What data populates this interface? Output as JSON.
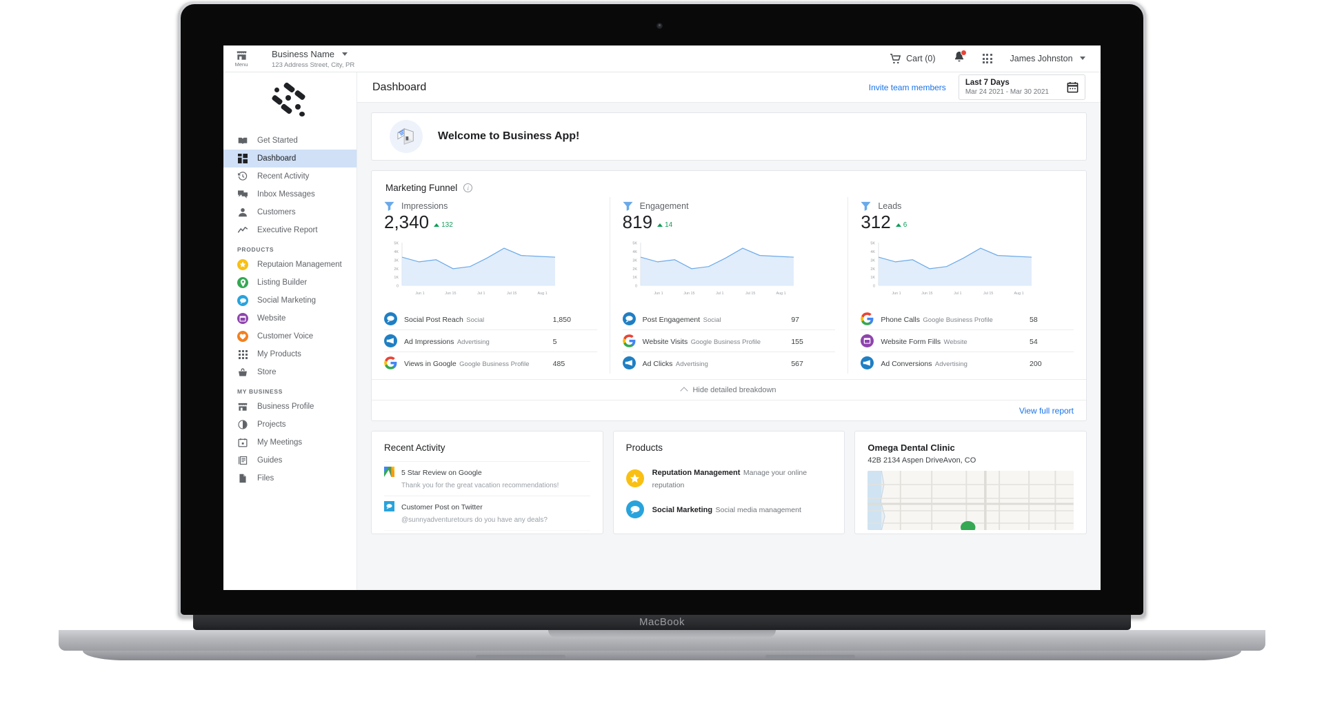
{
  "device": {
    "brand_label": "MacBook"
  },
  "topbar": {
    "menu_label": "Menu",
    "business_name": "Business Name",
    "business_address": "123 Address Street, City, PR",
    "cart_label": "Cart (0)",
    "user_name": "James Johnston"
  },
  "page": {
    "title": "Dashboard",
    "invite_link": "Invite team members",
    "date_label": "Last 7 Days",
    "date_range": "Mar 24 2021 - Mar 30 2021"
  },
  "welcome": {
    "text": "Welcome to Business App!"
  },
  "sidebar": {
    "main_items": [
      {
        "label": "Get Started",
        "icon": "book-icon",
        "active": false
      },
      {
        "label": "Dashboard",
        "icon": "dashboard-icon",
        "active": true
      },
      {
        "label": "Recent Activity",
        "icon": "history-icon",
        "active": false
      },
      {
        "label": "Inbox Messages",
        "icon": "chat-icon",
        "active": false
      },
      {
        "label": "Customers",
        "icon": "person-icon",
        "active": false
      },
      {
        "label": "Executive Report",
        "icon": "trending-icon",
        "active": false
      }
    ],
    "products_header": "PRODUCTS",
    "product_items": [
      {
        "label": "Reputaion Management",
        "icon": "star-circle-icon",
        "color": "#f9c013"
      },
      {
        "label": "Listing Builder",
        "icon": "map-pin-circle-icon",
        "color": "#34a853"
      },
      {
        "label": "Social Marketing",
        "icon": "social-circle-icon",
        "color": "#29a3dc"
      },
      {
        "label": "Website",
        "icon": "window-circle-icon",
        "color": "#8e44ad"
      },
      {
        "label": "Customer Voice",
        "icon": "heart-circle-icon",
        "color": "#f2801f"
      },
      {
        "label": "My Products",
        "icon": "grid-icon",
        "color": "#5f6368"
      },
      {
        "label": "Store",
        "icon": "basket-icon",
        "color": "#5f6368"
      }
    ],
    "business_header": "MY BUSINESS",
    "business_items": [
      {
        "label": "Business Profile",
        "icon": "storefront-icon"
      },
      {
        "label": "Projects",
        "icon": "pie-clock-icon"
      },
      {
        "label": "My Meetings",
        "icon": "calendar-icon"
      },
      {
        "label": "Guides",
        "icon": "guide-icon"
      },
      {
        "label": "Files",
        "icon": "file-icon"
      }
    ]
  },
  "funnel": {
    "title": "Marketing Funnel",
    "info_icon": "info-icon",
    "hide_breakdown_label": "Hide detailed breakdown",
    "view_full_report_label": "View full report",
    "columns": [
      {
        "name": "Impressions",
        "value": "2,340",
        "delta": "132",
        "breakdown": [
          {
            "label": "Social Post Reach",
            "sub": "Social",
            "value": "1,850",
            "bar_pct": 100,
            "icon": "social-circle-icon"
          },
          {
            "label": "Ad Impressions",
            "sub": "Advertising",
            "value": "5",
            "bar_pct": 14,
            "icon": "megaphone-circle-icon"
          },
          {
            "label": "Views in Google",
            "sub": "Google Business Profile",
            "value": "485",
            "bar_pct": 63,
            "icon": "google-icon"
          }
        ]
      },
      {
        "name": "Engagement",
        "value": "819",
        "delta": "14",
        "breakdown": [
          {
            "label": "Post Engagement",
            "sub": "Social",
            "value": "97",
            "bar_pct": 26,
            "icon": "social-circle-icon"
          },
          {
            "label": "Website Visits",
            "sub": "Google Business Profile",
            "value": "155",
            "bar_pct": 40,
            "icon": "google-icon"
          },
          {
            "label": "Ad Clicks",
            "sub": "Advertising",
            "value": "567",
            "bar_pct": 100,
            "icon": "megaphone-circle-icon"
          }
        ]
      },
      {
        "name": "Leads",
        "value": "312",
        "delta": "6",
        "breakdown": [
          {
            "label": "Phone Calls",
            "sub": "Google Business Profile",
            "value": "58",
            "bar_pct": 44,
            "icon": "google-icon"
          },
          {
            "label": "Website Form Fills",
            "sub": "Website",
            "value": "54",
            "bar_pct": 36,
            "icon": "window-circle-icon"
          },
          {
            "label": "Ad Conversions",
            "sub": "Advertising",
            "value": "200",
            "bar_pct": 100,
            "icon": "megaphone-circle-icon"
          }
        ]
      }
    ]
  },
  "chart_data": [
    {
      "type": "area",
      "title": "Impressions",
      "xlabel": "",
      "ylabel": "",
      "grid": false,
      "legend": "none",
      "ylim": [
        0,
        5000
      ],
      "ytick_labels": [
        "5K",
        "4K",
        "3K",
        "2K",
        "1K",
        "0"
      ],
      "ytick_values": [
        5000,
        4000,
        3000,
        2000,
        1000,
        0
      ],
      "xtick_labels": [
        "Jun 1",
        "Jun 15",
        "Jul 1",
        "Jul 15",
        "Aug 1"
      ],
      "x": [
        "Jun 1",
        "Jun 8",
        "Jun 15",
        "Jun 22",
        "Jul 1",
        "Jul 8",
        "Jul 15",
        "Jul 22",
        "Aug 1",
        "Aug 8"
      ],
      "values": [
        3300,
        2750,
        3000,
        1950,
        2200,
        3200,
        4350,
        3500,
        3400,
        3300
      ],
      "line_color": "#6aa9e9",
      "fill_color": "#dceafa"
    },
    {
      "type": "area",
      "title": "Engagement",
      "xlabel": "",
      "ylabel": "",
      "grid": false,
      "legend": "none",
      "ylim": [
        0,
        5000
      ],
      "ytick_labels": [
        "5K",
        "4K",
        "3K",
        "2K",
        "1K",
        "0"
      ],
      "ytick_values": [
        5000,
        4000,
        3000,
        2000,
        1000,
        0
      ],
      "xtick_labels": [
        "Jun 1",
        "Jun 15",
        "Jul 1",
        "Jul 15",
        "Aug 1"
      ],
      "x": [
        "Jun 1",
        "Jun 8",
        "Jun 15",
        "Jun 22",
        "Jul 1",
        "Jul 8",
        "Jul 15",
        "Jul 22",
        "Aug 1",
        "Aug 8"
      ],
      "values": [
        3300,
        2750,
        3000,
        1950,
        2200,
        3200,
        4350,
        3500,
        3400,
        3300
      ],
      "line_color": "#6aa9e9",
      "fill_color": "#dceafa"
    },
    {
      "type": "area",
      "title": "Leads",
      "xlabel": "",
      "ylabel": "",
      "grid": false,
      "legend": "none",
      "ylim": [
        0,
        5000
      ],
      "ytick_labels": [
        "5K",
        "4K",
        "3K",
        "2K",
        "1K",
        "0"
      ],
      "ytick_values": [
        5000,
        4000,
        3000,
        2000,
        1000,
        0
      ],
      "xtick_labels": [
        "Jun 1",
        "Jun 15",
        "Jul 1",
        "Jul 15",
        "Aug 1"
      ],
      "x": [
        "Jun 1",
        "Jun 8",
        "Jun 15",
        "Jun 22",
        "Jul 1",
        "Jul 8",
        "Jul 15",
        "Jul 22",
        "Aug 1",
        "Aug 8"
      ],
      "values": [
        3300,
        2750,
        3000,
        1950,
        2200,
        3200,
        4350,
        3500,
        3400,
        3300
      ],
      "line_color": "#6aa9e9",
      "fill_color": "#dceafa"
    }
  ],
  "recent_activity": {
    "title": "Recent Activity",
    "items": [
      {
        "title": "5 Star Review on Google",
        "sub": "Thank you for the great vacation recommendations!",
        "icon": "google-maps-icon"
      },
      {
        "title": "Customer Post on Twitter",
        "sub": "@sunnyadventuretours do you have any deals?",
        "icon": "twitter-icon"
      }
    ]
  },
  "products_card": {
    "title": "Products",
    "items": [
      {
        "title": "Reputation Management",
        "sub": "Manage your online reputation",
        "icon": "star-circle-icon",
        "color": "#f9c013"
      },
      {
        "title": "Social Marketing",
        "sub": "Social media management",
        "icon": "social-circle-icon",
        "color": "#29a3dc"
      }
    ]
  },
  "location_card": {
    "title": "Omega Dental Clinic",
    "address": "42B 2134 Aspen DriveAvon, CO",
    "map_icon": "map-thumbnail"
  }
}
